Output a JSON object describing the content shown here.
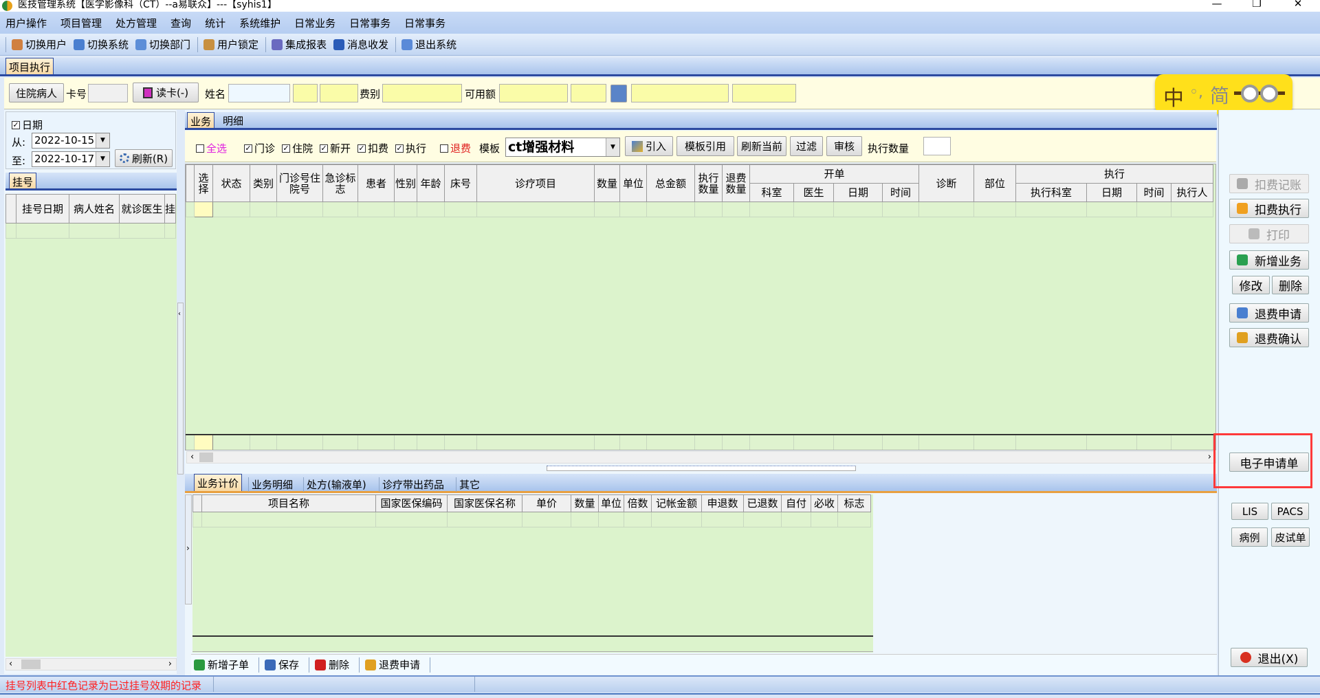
{
  "window": {
    "title": "医技管理系统【医学影像科（CT）--a易联众】---【syhis1】",
    "min": "—",
    "max": "❐",
    "close": "✕"
  },
  "menu": [
    "用户操作",
    "项目管理",
    "处方管理",
    "查询",
    "统计",
    "系统维护",
    "日常业务",
    "日常事务",
    "日常事务"
  ],
  "toolbar": [
    {
      "label": "切换用户",
      "icon": "switch-user-icon",
      "color": "#d08040"
    },
    {
      "label": "切换系统",
      "icon": "switch-system-icon",
      "color": "#4a7fd0"
    },
    {
      "label": "切换部门",
      "icon": "switch-dept-icon",
      "color": "#5c8ed8"
    },
    {
      "label": "用户锁定",
      "icon": "lock-user-icon",
      "color": "#c89040"
    },
    {
      "label": "集成报表",
      "icon": "report-icon",
      "color": "#6a6ac0"
    },
    {
      "label": "消息收发",
      "icon": "info-icon",
      "color": "#2a5cb8"
    },
    {
      "label": "退出系统",
      "icon": "exit-icon",
      "color": "#5a8ad8"
    }
  ],
  "main_tab": "项目执行",
  "patient": {
    "type_button": "住院病人",
    "card_label": "卡号",
    "card_value": "",
    "read_card": "读卡(-)",
    "name_label": "姓名",
    "fee_label": "费别",
    "avail_label": "可用额"
  },
  "ime": {
    "lang": "中",
    "punct": "◦,",
    "mode": "简"
  },
  "left": {
    "date_check": "日期",
    "from_label": "从:",
    "from_value": "2022-10-15",
    "to_label": "至:",
    "to_value": "2022-10-17",
    "refresh": "刷新(R)",
    "tab": "挂号",
    "columns": [
      "挂号日期",
      "病人姓名",
      "就诊医生",
      "挂"
    ]
  },
  "mid": {
    "tabs": [
      "业务",
      "明细"
    ],
    "filters": [
      {
        "label": "全选",
        "checked": false,
        "color": "#e020e0"
      },
      {
        "label": "门诊",
        "checked": true
      },
      {
        "label": "住院",
        "checked": true
      },
      {
        "label": "新开",
        "checked": true
      },
      {
        "label": "扣费",
        "checked": true
      },
      {
        "label": "执行",
        "checked": true
      },
      {
        "label": "退费",
        "checked": false,
        "color": "#e02020"
      }
    ],
    "template_label": "模板",
    "template_value": "ct增强材料",
    "import": "引入",
    "buttons": [
      "模板引用",
      "刷新当前",
      "过滤",
      "审核"
    ],
    "exec_qty_label": "执行数量",
    "columns": [
      "选择",
      "状态",
      "类别",
      "门诊号住院号",
      "急诊标志",
      "患者",
      "性别",
      "年龄",
      "床号",
      "诊疗项目",
      "数量",
      "单位",
      "总金额",
      "执行数量",
      "退费数量",
      "诊断",
      "部位"
    ],
    "group_open": "开单",
    "open_cols": [
      "科室",
      "医生",
      "日期",
      "时间"
    ],
    "group_exec": "执行",
    "exec_cols": [
      "执行科室",
      "日期",
      "时间",
      "执行人"
    ]
  },
  "detail": {
    "tabs": [
      "业务计价",
      "业务明细",
      "处方(输液单)",
      "诊疗带出药品",
      "其它"
    ],
    "columns": [
      "项目名称",
      "国家医保编码",
      "国家医保名称",
      "单价",
      "数量",
      "单位",
      "倍数",
      "记帐金额",
      "申退数",
      "已退数",
      "自付",
      "必收",
      "标志"
    ],
    "actions": [
      "新增子单",
      "保存",
      "删除",
      "退费申请"
    ]
  },
  "right": {
    "buttons": [
      "扣费记账",
      "扣费执行",
      "打印",
      "新增业务",
      "修改",
      "删除",
      "退费申请",
      "退费确认",
      "电子申请单",
      "LIS",
      "PACS",
      "病例",
      "皮试单",
      "退出(X)"
    ]
  },
  "status": {
    "message": "挂号列表中红色记录为已过挂号效期的记录"
  },
  "colors": {
    "grid_bg": "#dcf3cc",
    "highlight": "#ff3030",
    "warning_text": "#ff2020"
  }
}
